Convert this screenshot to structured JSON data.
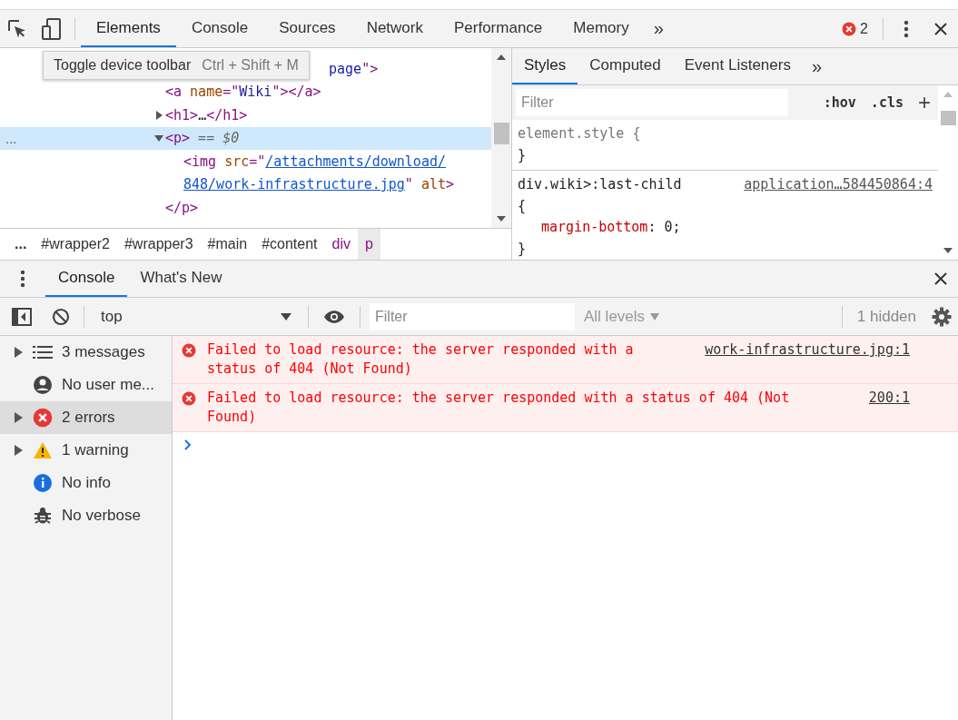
{
  "toolbar": {
    "tabs": [
      {
        "label": "Elements",
        "selected": true
      },
      {
        "label": "Console",
        "selected": false
      },
      {
        "label": "Sources",
        "selected": false
      },
      {
        "label": "Network",
        "selected": false
      },
      {
        "label": "Performance",
        "selected": false
      },
      {
        "label": "Memory",
        "selected": false
      }
    ],
    "more": "»",
    "error_count": "2"
  },
  "tooltip": {
    "label": "Toggle device toolbar",
    "shortcut": "Ctrl + Shift + M"
  },
  "dom_tree": [
    {
      "kind": "clipped",
      "selected": false,
      "tokens": [
        {
          "kind": "value",
          "text": "page"
        },
        {
          "kind": "tag",
          "text": "\">"
        }
      ]
    },
    {
      "kind": "leaf",
      "selected": false,
      "tokens": [
        {
          "kind": "tag",
          "text": "<a"
        },
        {
          "kind": "attr",
          "text": " name"
        },
        {
          "kind": "tag",
          "text": "=\""
        },
        {
          "kind": "value",
          "text": "Wiki"
        },
        {
          "kind": "tag",
          "text": "\"></a>"
        }
      ]
    },
    {
      "kind": "node",
      "selected": false,
      "expanded": false,
      "tokens": [
        {
          "kind": "tag",
          "text": "<h1>"
        },
        {
          "kind": "plain",
          "text": "…"
        },
        {
          "kind": "tag",
          "text": "</h1>"
        }
      ]
    },
    {
      "kind": "node",
      "selected": true,
      "expanded": true,
      "marker": "...",
      "tokens": [
        {
          "kind": "tag",
          "text": "<p>"
        },
        {
          "kind": "note",
          "text": " == $0"
        }
      ],
      "children": [
        {
          "kind": "leaf",
          "selected": false,
          "tokens": [
            {
              "kind": "tag",
              "text": "<img"
            },
            {
              "kind": "attr",
              "text": " src"
            },
            {
              "kind": "tag",
              "text": "=\""
            },
            {
              "kind": "link",
              "text": "/attachments/download/"
            }
          ]
        },
        {
          "kind": "leaf",
          "selected": false,
          "tokens": [
            {
              "kind": "link",
              "text": "848/work-infrastructure.jpg"
            },
            {
              "kind": "tag",
              "text": "\""
            },
            {
              "kind": "attr",
              "text": " alt"
            },
            {
              "kind": "tag",
              "text": ">"
            }
          ]
        }
      ],
      "closing": [
        {
          "kind": "tag",
          "text": "</p>"
        }
      ]
    }
  ],
  "breadcrumbs": [
    {
      "label": "...",
      "kind": "more",
      "selected": false
    },
    {
      "label": "#wrapper2",
      "kind": "id",
      "selected": false
    },
    {
      "label": "#wrapper3",
      "kind": "id",
      "selected": false
    },
    {
      "label": "#main",
      "kind": "id",
      "selected": false
    },
    {
      "label": "#content",
      "kind": "id",
      "selected": false
    },
    {
      "label": "div",
      "kind": "tag",
      "selected": false
    },
    {
      "label": "p",
      "kind": "tag",
      "selected": true
    }
  ],
  "styles": {
    "tabs": [
      {
        "label": "Styles",
        "selected": true
      },
      {
        "label": "Computed",
        "selected": false
      },
      {
        "label": "Event Listeners",
        "selected": false
      }
    ],
    "more": "»",
    "filter_placeholder": "Filter",
    "hov": ":hov",
    "cls": ".cls",
    "add": "+",
    "rules": [
      {
        "selector": "element.style {",
        "close": "}"
      },
      {
        "selector": "div.wiki>:last-child",
        "source": "application…584450864:4",
        "open": "{",
        "properties": [
          {
            "name": "margin-bottom",
            "separator": ":",
            "value": "0;"
          }
        ],
        "close": "}"
      }
    ]
  },
  "drawer": {
    "tabs": [
      {
        "label": "Console",
        "selected": true
      },
      {
        "label": "What's New",
        "selected": false
      }
    ],
    "context": "top",
    "filter_placeholder": "Filter",
    "levels": "All levels",
    "hidden": "1 hidden"
  },
  "sidebar": [
    {
      "kind": "list",
      "label": "3 messages",
      "expandable": true,
      "selected": false
    },
    {
      "kind": "user",
      "label": "No user me...",
      "expandable": false,
      "selected": false
    },
    {
      "kind": "error",
      "label": "2 errors",
      "expandable": true,
      "selected": true
    },
    {
      "kind": "warning",
      "label": "1 warning",
      "expandable": true,
      "selected": false
    },
    {
      "kind": "info",
      "label": "No info",
      "expandable": false,
      "selected": false
    },
    {
      "kind": "verbose",
      "label": "No verbose",
      "expandable": false,
      "selected": false
    }
  ],
  "messages": [
    {
      "kind": "error",
      "text": "Failed to load resource: the server responded with a status of 404 (Not Found)",
      "source": "work-infrastructure.jpg:1"
    },
    {
      "kind": "error",
      "text": "Failed to load resource: the server responded with a status of 404 (Not Found)",
      "source": "200:1"
    }
  ]
}
